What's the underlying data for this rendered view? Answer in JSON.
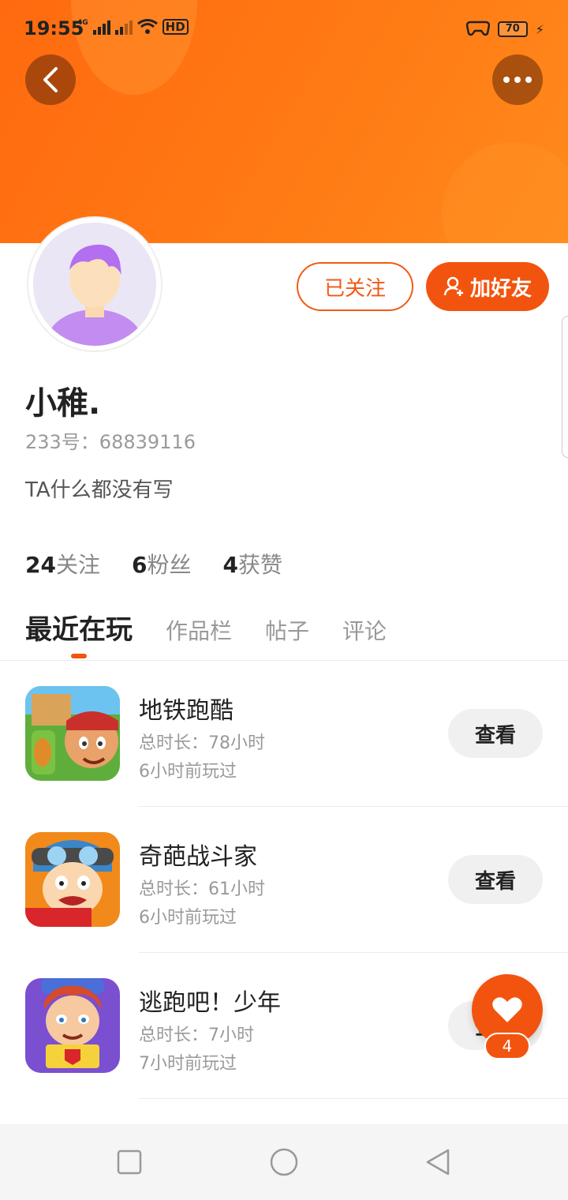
{
  "status_bar": {
    "time": "19:55",
    "network_label": "4G",
    "hd_label": "HD",
    "battery": "70"
  },
  "header": {
    "back_icon": "chevron-left-icon",
    "more_icon": "more-dots-icon"
  },
  "profile": {
    "follow_label": "已关注",
    "add_friend_label": "加好友",
    "username": "小稚.",
    "uid": "233号：68839116",
    "bio": "TA什么都没有写",
    "stats": [
      {
        "num": "24",
        "label": "关注"
      },
      {
        "num": "6",
        "label": "粉丝"
      },
      {
        "num": "4",
        "label": "获赞"
      }
    ]
  },
  "tabs": [
    {
      "label": "最近在玩",
      "active": true
    },
    {
      "label": "作品栏",
      "active": false
    },
    {
      "label": "帖子",
      "active": false
    },
    {
      "label": "评论",
      "active": false
    }
  ],
  "games": [
    {
      "name": "地铁跑酷",
      "duration": "总时长：78小时",
      "last_played": "6小时前玩过",
      "button": "查看"
    },
    {
      "name": "奇葩战斗家",
      "duration": "总时长：61小时",
      "last_played": "6小时前玩过",
      "button": "查看"
    },
    {
      "name": "逃跑吧！少年",
      "duration": "总时长：7小时",
      "last_played": "7小时前玩过",
      "button": "查看"
    }
  ],
  "like": {
    "count": "4",
    "icon": "heart-icon"
  },
  "colors": {
    "accent": "#f2540f",
    "header": "#ff7a14"
  }
}
